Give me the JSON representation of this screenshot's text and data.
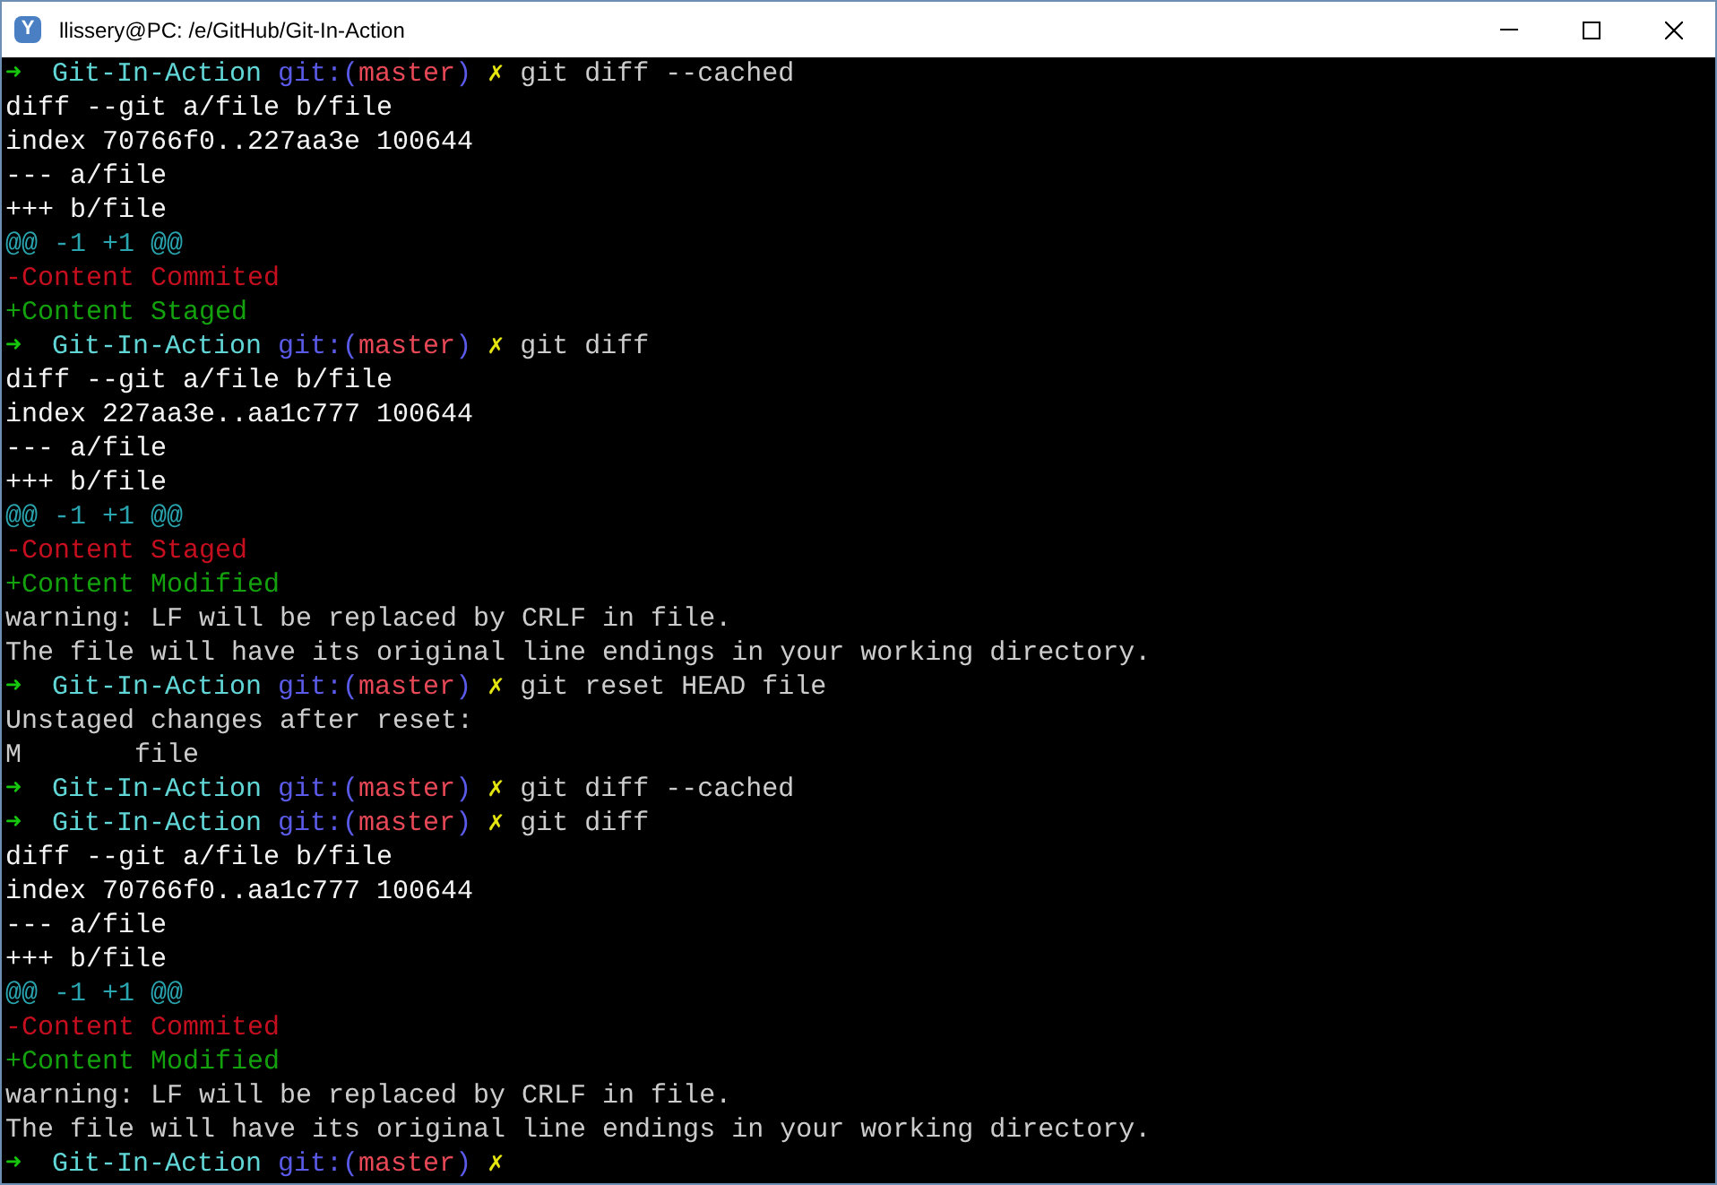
{
  "window": {
    "icon_letter": "Y",
    "title": "llissery@PC: /e/GitHub/Git-In-Action"
  },
  "terminal": {
    "lines": [
      {
        "kind": "prompt",
        "arrow": "➜",
        "directory": "Git-In-Action",
        "git_open": "git:(",
        "branch": "master",
        "git_close": ")",
        "dirty_mark": "✗",
        "command": "git diff --cached"
      },
      {
        "kind": "meta",
        "text": "diff --git a/file b/file"
      },
      {
        "kind": "meta",
        "text": "index 70766f0..227aa3e 100644"
      },
      {
        "kind": "meta",
        "text": "--- a/file"
      },
      {
        "kind": "meta",
        "text": "+++ b/file"
      },
      {
        "kind": "hunk",
        "text": "@@ -1 +1 @@"
      },
      {
        "kind": "removed",
        "text": "-Content Commited"
      },
      {
        "kind": "added",
        "text": "+Content Staged"
      },
      {
        "kind": "prompt",
        "arrow": "➜",
        "directory": "Git-In-Action",
        "git_open": "git:(",
        "branch": "master",
        "git_close": ")",
        "dirty_mark": "✗",
        "command": "git diff"
      },
      {
        "kind": "meta",
        "text": "diff --git a/file b/file"
      },
      {
        "kind": "meta",
        "text": "index 227aa3e..aa1c777 100644"
      },
      {
        "kind": "meta",
        "text": "--- a/file"
      },
      {
        "kind": "meta",
        "text": "+++ b/file"
      },
      {
        "kind": "hunk",
        "text": "@@ -1 +1 @@"
      },
      {
        "kind": "removed",
        "text": "-Content Staged"
      },
      {
        "kind": "added",
        "text": "+Content Modified"
      },
      {
        "kind": "plain",
        "text": "warning: LF will be replaced by CRLF in file."
      },
      {
        "kind": "plain",
        "text": "The file will have its original line endings in your working directory."
      },
      {
        "kind": "prompt",
        "arrow": "➜",
        "directory": "Git-In-Action",
        "git_open": "git:(",
        "branch": "master",
        "git_close": ")",
        "dirty_mark": "✗",
        "command": "git reset HEAD file"
      },
      {
        "kind": "plain",
        "text": "Unstaged changes after reset:"
      },
      {
        "kind": "plain",
        "text": "M       file"
      },
      {
        "kind": "prompt",
        "arrow": "➜",
        "directory": "Git-In-Action",
        "git_open": "git:(",
        "branch": "master",
        "git_close": ")",
        "dirty_mark": "✗",
        "command": "git diff --cached"
      },
      {
        "kind": "prompt",
        "arrow": "➜",
        "directory": "Git-In-Action",
        "git_open": "git:(",
        "branch": "master",
        "git_close": ")",
        "dirty_mark": "✗",
        "command": "git diff"
      },
      {
        "kind": "meta",
        "text": "diff --git a/file b/file"
      },
      {
        "kind": "meta",
        "text": "index 70766f0..aa1c777 100644"
      },
      {
        "kind": "meta",
        "text": "--- a/file"
      },
      {
        "kind": "meta",
        "text": "+++ b/file"
      },
      {
        "kind": "hunk",
        "text": "@@ -1 +1 @@"
      },
      {
        "kind": "removed",
        "text": "-Content Commited"
      },
      {
        "kind": "added",
        "text": "+Content Modified"
      },
      {
        "kind": "plain",
        "text": "warning: LF will be replaced by CRLF in file."
      },
      {
        "kind": "plain",
        "text": "The file will have its original line endings in your working directory."
      },
      {
        "kind": "prompt",
        "arrow": "➜",
        "directory": "Git-In-Action",
        "git_open": "git:(",
        "branch": "master",
        "git_close": ")",
        "dirty_mark": "✗"
      }
    ]
  }
}
